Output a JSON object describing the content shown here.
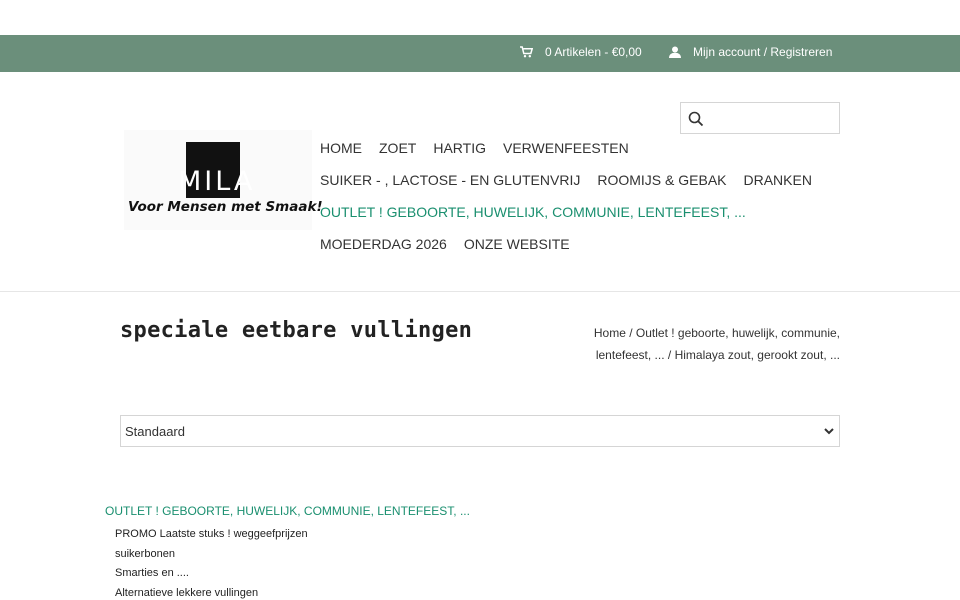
{
  "topbar": {
    "cart_label": "0 Artikelen - €0,00",
    "account_label": "Mijn account / Registreren",
    "background": "#6b8f7b",
    "cart_icon": "cart-icon",
    "account_icon": "user-icon"
  },
  "logo": {
    "text": "MILA",
    "tagline": "Voor Mensen met Smaak!"
  },
  "search": {
    "placeholder": "",
    "icon": "search-icon"
  },
  "nav": {
    "row1": [
      "Home",
      "Zoet",
      "Hartig",
      "Verwenfeesten"
    ],
    "row2": [
      "Suiker - , lactose - en glutenvrij",
      "Roomijs & gebak",
      "Dranken"
    ],
    "row3": [
      "Outlet ! geboorte, huwelijk, communie, lentefeest, ..."
    ],
    "row4": [
      "Moederdag 2026",
      "Onze website"
    ],
    "active_color": "#1a8f6f"
  },
  "page": {
    "title": "speciale eetbare vullingen"
  },
  "breadcrumb": {
    "home": "Home",
    "sep": " / ",
    "outlet": "Outlet ! geboorte, huwelijk, communie, lentefeest, ...",
    "current": "Himalaya zout, gerookt zout, ..."
  },
  "sort": {
    "selected": "Standaard"
  },
  "sidebar": {
    "category": "OUTLET ! GEBOORTE, HUWELIJK, COMMUNIE, LENTEFEEST, ...",
    "items": [
      "PROMO Laatste stuks ! weggeefprijzen",
      "suikerbonen",
      "Smarties en ....",
      "Alternatieve lekkere vullingen"
    ]
  }
}
